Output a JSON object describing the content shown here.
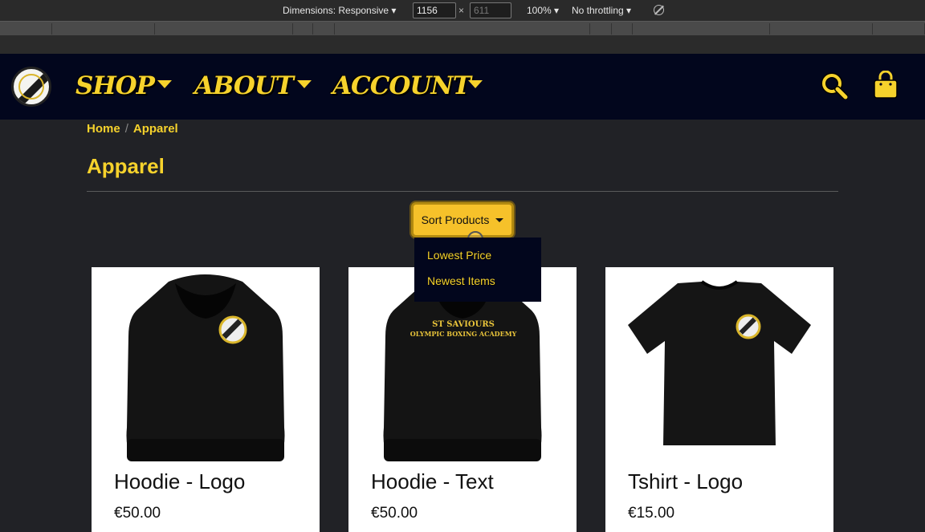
{
  "devtools": {
    "dimensions_label": "Dimensions: Responsive ▾",
    "width_value": "1156",
    "height_value": "611",
    "zoom_label": "100% ▾",
    "throttling_label": "No throttling ▾",
    "times": "×"
  },
  "header": {
    "nav": [
      "SHOP",
      "ABOUT",
      "ACCOUNT"
    ]
  },
  "breadcrumb": {
    "home": "Home",
    "separator": "/",
    "current": "Apparel"
  },
  "page_title": "Apparel",
  "sort": {
    "label": "Sort Products",
    "options": [
      "Lowest Price",
      "Newest Items"
    ]
  },
  "products": [
    {
      "name": "Hoodie - Logo",
      "price": "€50.00"
    },
    {
      "name": "Hoodie - Text",
      "price": "€50.00",
      "print_line1": "ST SAVIOURS",
      "print_line2": "OLYMPIC BOXING ACADEMY"
    },
    {
      "name": "Tshirt - Logo",
      "price": "€15.00"
    }
  ],
  "colors": {
    "header_bg": "#02061d",
    "accent": "#f6d22c",
    "page_bg": "#212226",
    "button": "#f6c12a"
  }
}
